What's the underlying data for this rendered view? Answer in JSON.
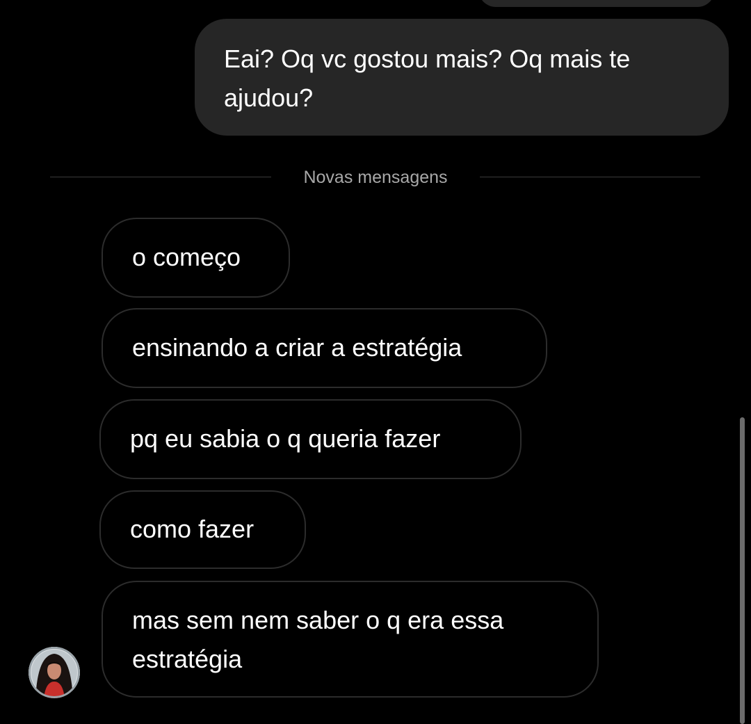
{
  "conversation": {
    "sent_messages": [
      {
        "text": "Eai? Oq vc gostou mais? Oq mais te ajudou?"
      }
    ],
    "new_messages_divider": "Novas mensagens",
    "received_messages": [
      {
        "text": "o começo"
      },
      {
        "text": "ensinando a criar a estratégia"
      },
      {
        "text": "pq eu sabia o q queria fazer"
      },
      {
        "text": "como fazer"
      },
      {
        "text": "mas sem nem saber o q era essa estratégia"
      }
    ]
  },
  "icons": {
    "avatar": "profile-photo-avatar"
  },
  "colors": {
    "background": "#000000",
    "sent_bubble": "#262626",
    "received_border": "#2c2c2c",
    "divider_text": "#a8a8a8"
  }
}
